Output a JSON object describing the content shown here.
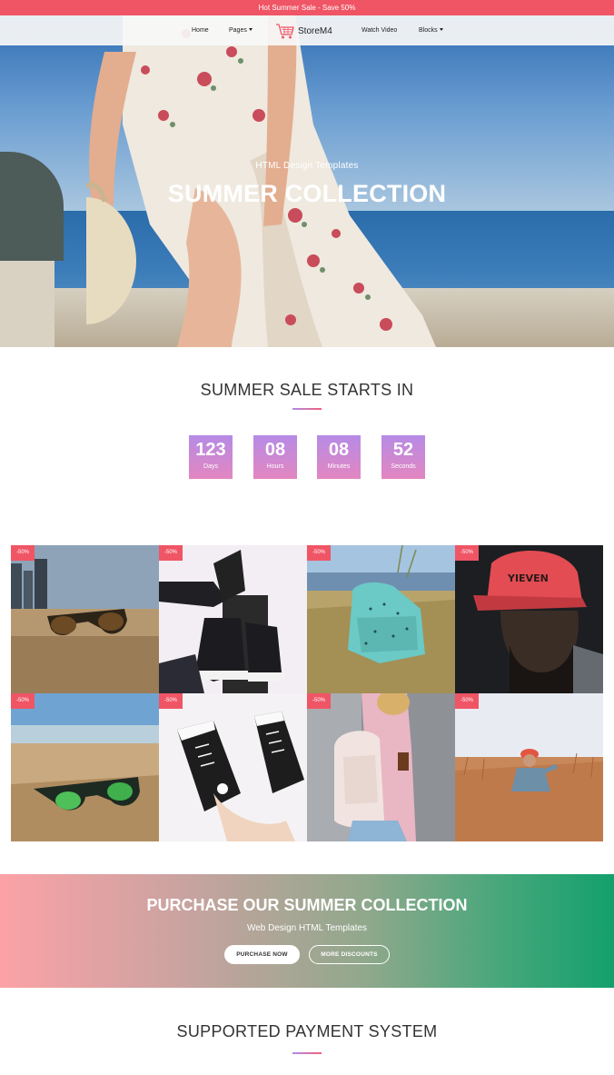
{
  "topbar": {
    "text": "Hot Summer Sale - Save 50%"
  },
  "nav": {
    "home": "Home",
    "pages": "Pages",
    "brand": "StoreM4",
    "watch_video": "Watch Video",
    "blocks": "Blocks"
  },
  "hero": {
    "subtitle": "HTML Design Templates",
    "title": "SUMMER COLLECTION"
  },
  "countdown": {
    "title": "SUMMER SALE STARTS IN",
    "items": [
      {
        "value": "123",
        "label": "Days"
      },
      {
        "value": "08",
        "label": "Hours"
      },
      {
        "value": "08",
        "label": "Minutes"
      },
      {
        "value": "52",
        "label": "Seconds"
      }
    ]
  },
  "products": {
    "badge": "-50%",
    "items": [
      {
        "icon": "sunglasses-on-sand-image"
      },
      {
        "icon": "black-sneakers-image"
      },
      {
        "icon": "teal-backpack-image"
      },
      {
        "icon": "red-cap-man-image"
      },
      {
        "icon": "green-sunglasses-beach-image"
      },
      {
        "icon": "converse-sneakers-image"
      },
      {
        "icon": "pink-backpack-image"
      },
      {
        "icon": "field-hiker-image"
      }
    ]
  },
  "banner": {
    "title": "PURCHASE OUR SUMMER COLLECTION",
    "subtitle": "Web Design HTML Templates",
    "purchase_label": "PURCHASE NOW",
    "discounts_label": "MORE DISCOUNTS"
  },
  "payment": {
    "title": "SUPPORTED PAYMENT SYSTEM"
  },
  "colors": {
    "accent": "#ef5565",
    "gradient_purple": "#b68be6",
    "gradient_green": "#13a06c"
  }
}
